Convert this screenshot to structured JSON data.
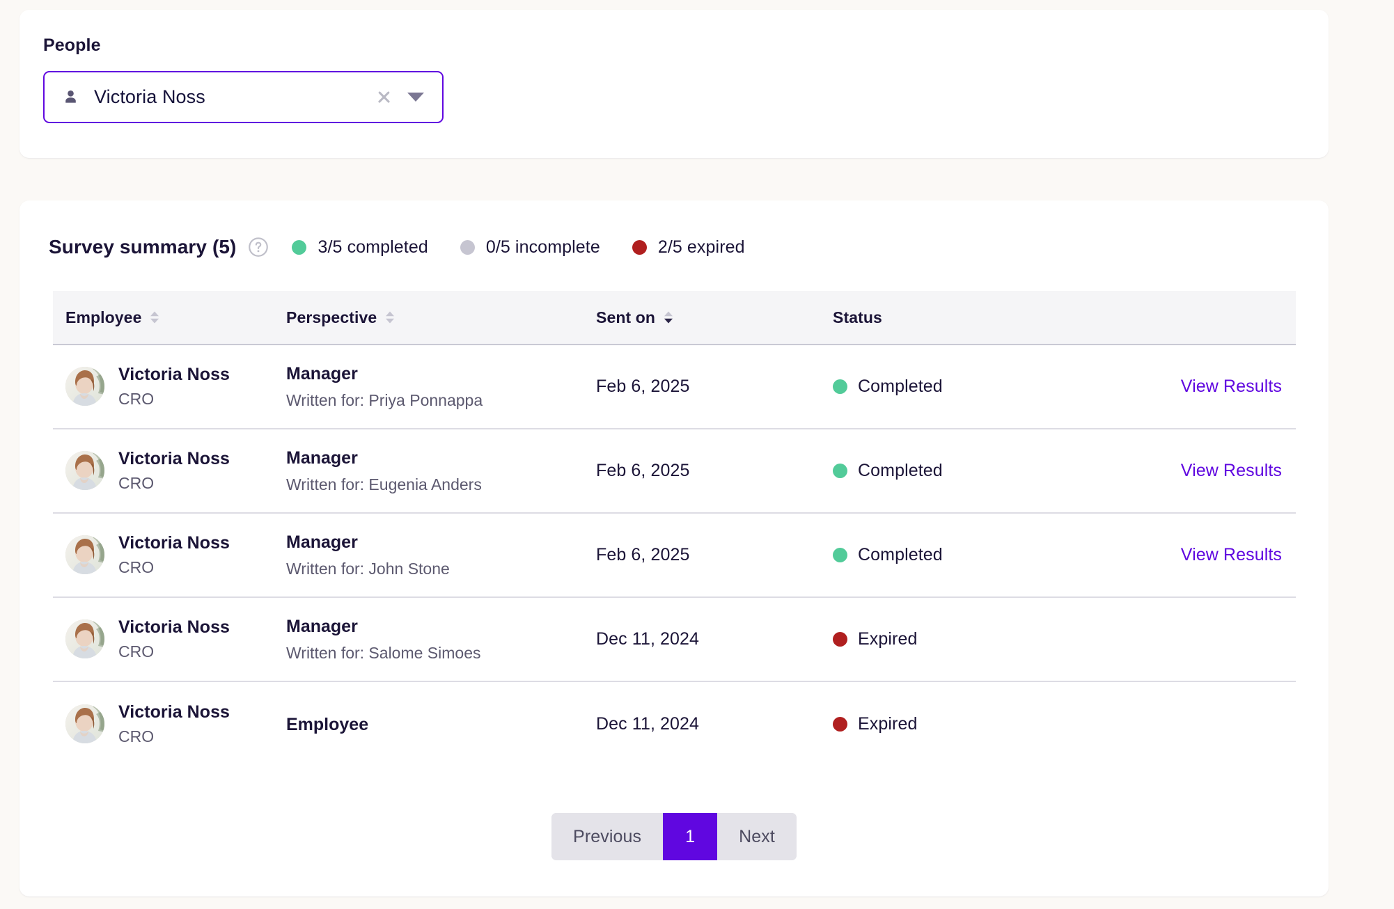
{
  "filter": {
    "label": "People",
    "person_icon": "person-icon",
    "selected_value": "Victoria Noss",
    "clear_icon": "close-icon",
    "caret_icon": "chevron-down-icon"
  },
  "summary": {
    "title": "Survey summary (5)",
    "help_icon": "help-icon",
    "legend": [
      {
        "color": "#52CB99",
        "label": "3/5 completed",
        "key": "completed"
      },
      {
        "color": "#C6C5D1",
        "label": "0/5 incomplete",
        "key": "incomplete"
      },
      {
        "color": "#B01F1F",
        "label": "2/5 expired",
        "key": "expired"
      }
    ]
  },
  "table": {
    "columns": [
      {
        "label": "Employee",
        "sortable": true,
        "sort": "none"
      },
      {
        "label": "Perspective",
        "sortable": true,
        "sort": "none"
      },
      {
        "label": "Sent on",
        "sortable": true,
        "sort": "desc"
      },
      {
        "label": "Status",
        "sortable": false,
        "sort": "none"
      },
      {
        "label": "",
        "sortable": false,
        "sort": "none"
      }
    ],
    "rows": [
      {
        "employee_name": "Victoria Noss",
        "employee_role": "CRO",
        "perspective": "Manager",
        "perspective_sub": "Written for: Priya Ponnappa",
        "sent_on": "Feb 6, 2025",
        "status": "Completed",
        "status_color": "green",
        "action": "View Results"
      },
      {
        "employee_name": "Victoria Noss",
        "employee_role": "CRO",
        "perspective": "Manager",
        "perspective_sub": "Written for: Eugenia Anders",
        "sent_on": "Feb 6, 2025",
        "status": "Completed",
        "status_color": "green",
        "action": "View Results"
      },
      {
        "employee_name": "Victoria Noss",
        "employee_role": "CRO",
        "perspective": "Manager",
        "perspective_sub": "Written for: John Stone",
        "sent_on": "Feb 6, 2025",
        "status": "Completed",
        "status_color": "green",
        "action": "View Results"
      },
      {
        "employee_name": "Victoria Noss",
        "employee_role": "CRO",
        "perspective": "Manager",
        "perspective_sub": "Written for: Salome Simoes",
        "sent_on": "Dec 11, 2024",
        "status": "Expired",
        "status_color": "red",
        "action": ""
      },
      {
        "employee_name": "Victoria Noss",
        "employee_role": "CRO",
        "perspective": "Employee",
        "perspective_sub": "",
        "sent_on": "Dec 11, 2024",
        "status": "Expired",
        "status_color": "red",
        "action": ""
      }
    ]
  },
  "pagination": {
    "previous_label": "Previous",
    "current_page": "1",
    "next_label": "Next"
  },
  "colors": {
    "accent": "#6007E0",
    "page_background": "#FBF9F6",
    "card_background": "#FFFFFF",
    "text_primary": "#1B1437",
    "text_secondary": "#5C596F",
    "status_completed": "#52CB99",
    "status_incomplete": "#C6C5D1",
    "status_expired": "#B01F1F",
    "table_header_background": "#F5F5F7"
  }
}
